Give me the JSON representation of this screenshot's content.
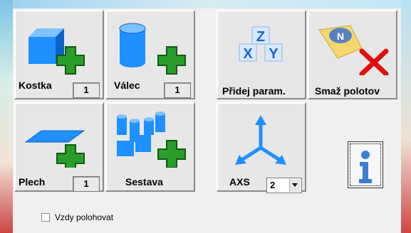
{
  "tiles": {
    "kostka": {
      "label": "Kostka",
      "count": "1",
      "icon": "cube-add-icon"
    },
    "valec": {
      "label": "Válec",
      "count": "1",
      "icon": "cylinder-add-icon"
    },
    "pridej": {
      "label": "Přidej param.",
      "icon": "xyz-blocks-icon"
    },
    "smaz": {
      "label": "Smaž polotov",
      "icon": "delete-stock-icon"
    },
    "plech": {
      "label": "Plech",
      "count": "1",
      "icon": "sheet-add-icon"
    },
    "sestava": {
      "label": "Sestava",
      "icon": "assembly-add-icon"
    },
    "axs": {
      "label": "AXS",
      "value": "2",
      "icon": "axes-icon"
    }
  },
  "info_button": {
    "icon": "info-icon"
  },
  "checkbox": {
    "label": "Vzdy polohovat",
    "checked": false
  },
  "colors": {
    "blue": "#1e90ff",
    "green": "#2a9d2a",
    "red": "#e01010"
  }
}
